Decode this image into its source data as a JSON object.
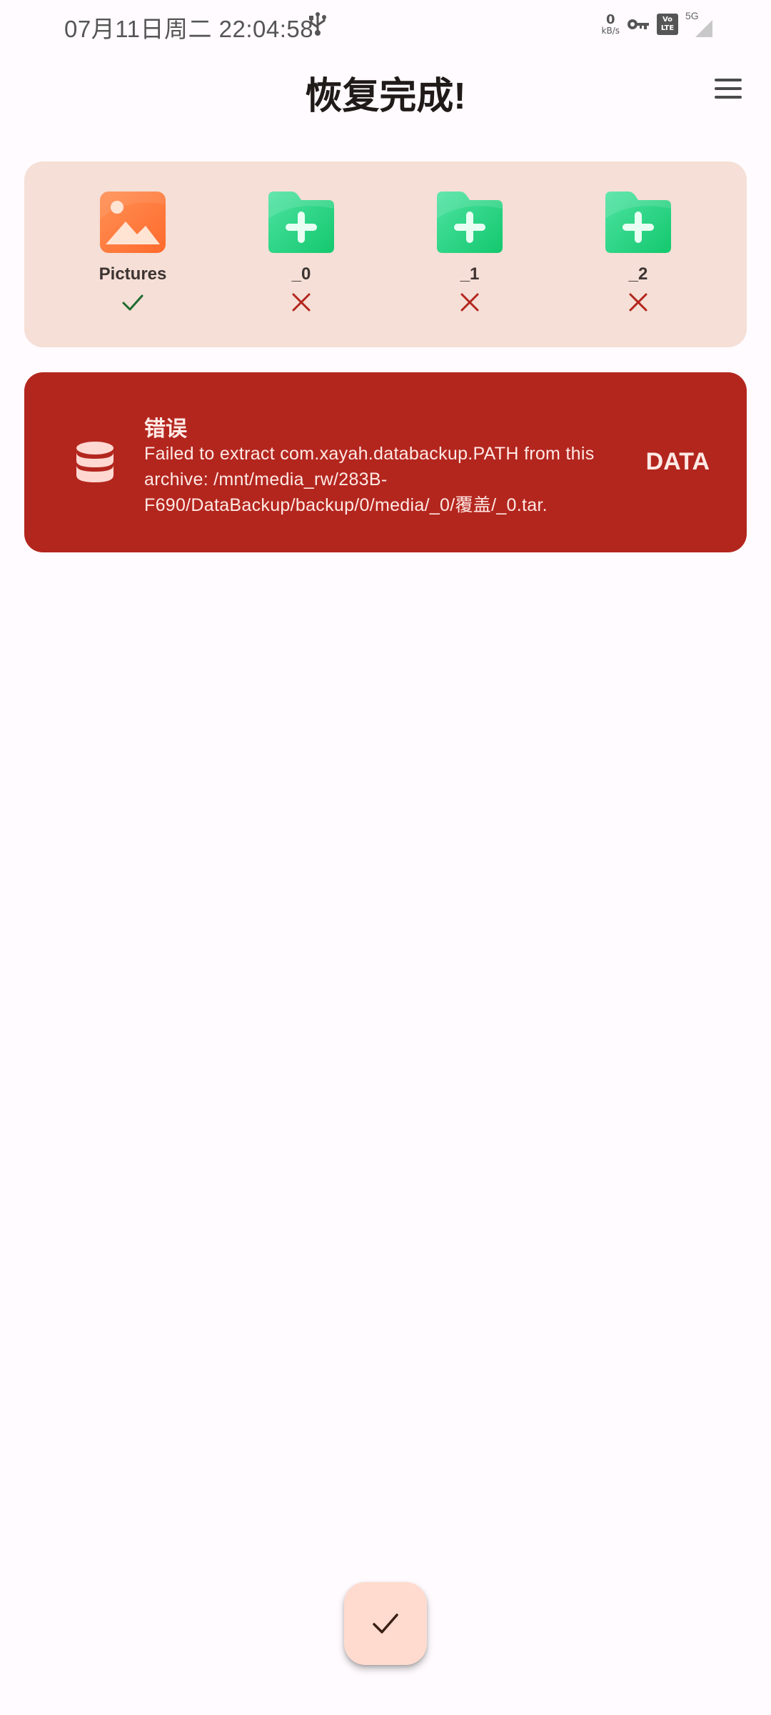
{
  "status_bar": {
    "time": "07月11日周二 22:04:58",
    "net_speed_value": "0",
    "net_speed_unit": "kB/s",
    "network_label": "5G",
    "volte_top": "Vo",
    "volte_bottom": "LTE",
    "icons": [
      "usb-icon",
      "key-icon",
      "volte-icon",
      "signal-icon"
    ]
  },
  "header": {
    "title": "恢复完成!",
    "menu_icon": "menu-icon"
  },
  "items": [
    {
      "label": "Pictures",
      "icon": "image-icon",
      "status": "success"
    },
    {
      "label": "_0",
      "icon": "folder-add-icon",
      "status": "failed"
    },
    {
      "label": "_1",
      "icon": "folder-add-icon",
      "status": "failed"
    },
    {
      "label": "_2",
      "icon": "folder-add-icon",
      "status": "failed"
    }
  ],
  "error": {
    "title": "错误",
    "message": "Failed to extract com.xayah.databackup.PATH from this archive: /mnt/media_rw/283B-F690/DataBackup/backup/0/media/_0/覆盖/_0.tar.",
    "type": "DATA",
    "icon": "database-icon"
  },
  "fab": {
    "icon": "check-icon"
  },
  "colors": {
    "background": "#fffbfe",
    "items_card": "#f5dfd6",
    "error_card": "#b3261e",
    "success": "#1e6b2f",
    "failed": "#b3261e",
    "fab": "#ffdbcf",
    "image_icon": "#ff7a3d",
    "folder_icon": "#1ecf7a"
  }
}
